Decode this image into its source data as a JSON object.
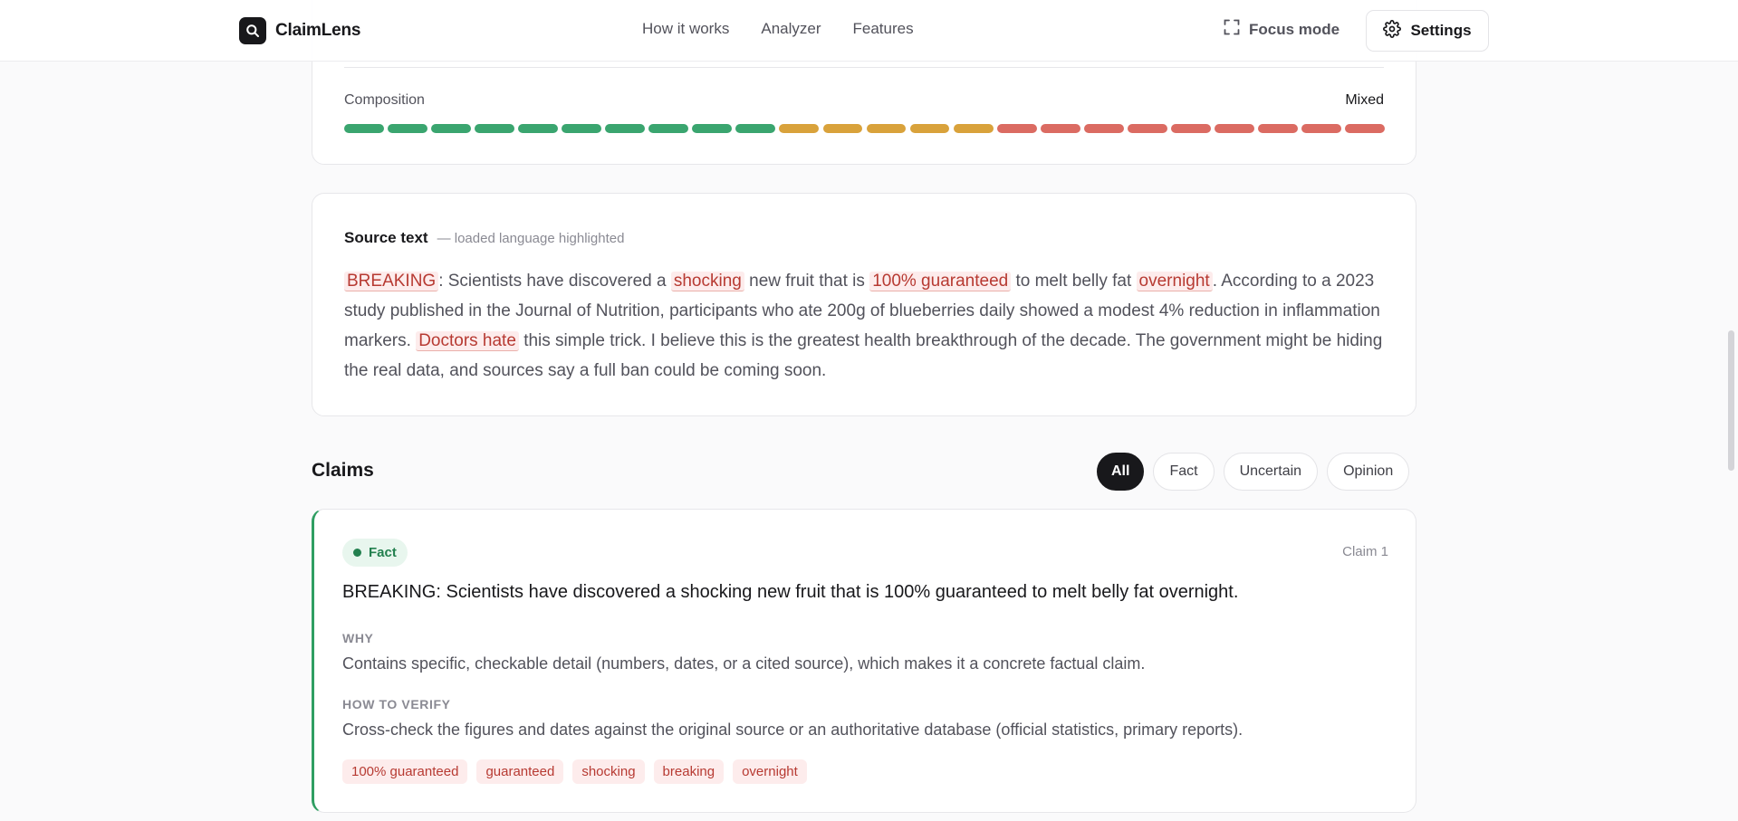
{
  "header": {
    "brand": "ClaimLens",
    "nav": [
      "How it works",
      "Analyzer",
      "Features"
    ],
    "focus_label": "Focus mode",
    "settings_label": "Settings"
  },
  "composition": {
    "label": "Composition",
    "value": "Mixed",
    "segments": [
      "fact",
      "fact",
      "fact",
      "fact",
      "fact",
      "fact",
      "fact",
      "fact",
      "fact",
      "fact",
      "uncertain",
      "uncertain",
      "uncertain",
      "uncertain",
      "uncertain",
      "opinion",
      "opinion",
      "opinion",
      "opinion",
      "opinion",
      "opinion",
      "opinion",
      "opinion",
      "opinion"
    ]
  },
  "source": {
    "title": "Source text",
    "subtitle": "— loaded language highlighted",
    "parts": [
      {
        "t": "BREAKING",
        "hl": true
      },
      {
        "t": ": Scientists have discovered a ",
        "hl": false
      },
      {
        "t": "shocking",
        "hl": true
      },
      {
        "t": " new fruit that is ",
        "hl": false
      },
      {
        "t": "100% guaranteed",
        "hl": true
      },
      {
        "t": " to melt belly fat ",
        "hl": false
      },
      {
        "t": "overnight",
        "hl": true
      },
      {
        "t": ". According to a 2023 study published in the Journal of Nutrition, participants who ate 200g of blueberries daily showed a modest 4% reduction in inflammation markers. ",
        "hl": false
      },
      {
        "t": "Doctors hate",
        "hl": true
      },
      {
        "t": " this simple trick. I believe this is the greatest health breakthrough of the decade. The government might be hiding the real data, and sources say a full ban could be coming soon.",
        "hl": false
      }
    ]
  },
  "claims": {
    "title": "Claims",
    "filters": [
      {
        "label": "All",
        "active": true
      },
      {
        "label": "Fact",
        "active": false
      },
      {
        "label": "Uncertain",
        "active": false
      },
      {
        "label": "Opinion",
        "active": false
      }
    ],
    "items": [
      {
        "badge": "Fact",
        "number": "Claim 1",
        "text": "BREAKING: Scientists have discovered a shocking new fruit that is 100% guaranteed to melt belly fat overnight.",
        "why_label": "WHY",
        "why": "Contains specific, checkable detail (numbers, dates, or a cited source), which makes it a concrete factual claim.",
        "verify_label": "HOW TO VERIFY",
        "verify": "Cross-check the figures and dates against the original source or an authoritative database (official statistics, primary reports).",
        "tags": [
          "100% guaranteed",
          "guaranteed",
          "shocking",
          "breaking",
          "overnight"
        ]
      }
    ]
  },
  "colors": {
    "fact": "#3aa56f",
    "uncertain": "#d9a23b",
    "opinion": "#db6b62"
  }
}
